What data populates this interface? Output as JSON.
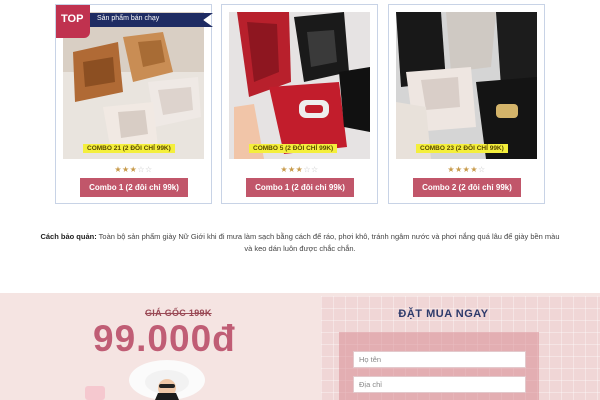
{
  "badges": {
    "top_label": "TOP",
    "best_seller": "Sản phẩm bán chạy"
  },
  "products": [
    {
      "caption": "COMBO 21 (2 ĐÔI CHỈ 99K)",
      "rating": 3,
      "max_rating": 5,
      "button": "Combo 1 (2 đôi chỉ 99k)"
    },
    {
      "caption": "COMBO 5 (2 ĐÔI CHỈ 99K)",
      "rating": 3,
      "max_rating": 5,
      "button": "Combo 1 (2 đôi chỉ 99k)"
    },
    {
      "caption": "COMBO 23 (2 ĐÔI CHỈ 99K)",
      "rating": 4,
      "max_rating": 5,
      "button": "Combo 2 (2 đôi chỉ 99k)"
    }
  ],
  "care": {
    "label": "Cách bảo quản:",
    "text": " Toàn bộ sản phẩm giày Nữ Giới khi đi mưa làm sạch bằng cách để ráo, phơi khô, tránh ngâm nước và phơi nắng quá lâu để giày bền màu và keo dán luôn được chắc chắn."
  },
  "promo": {
    "old_price": "GIÁ GỐC 199K",
    "price": "99.000đ"
  },
  "order_form": {
    "title": "ĐẶT MUA NGAY",
    "name_placeholder": "Họ tên",
    "address_placeholder": "Địa chỉ"
  },
  "colors": {
    "accent": "#c1566a",
    "price": "#c05d75",
    "navy": "#1f2c63",
    "promo_bg": "#f5e4e2",
    "star": "#c79a4a"
  }
}
